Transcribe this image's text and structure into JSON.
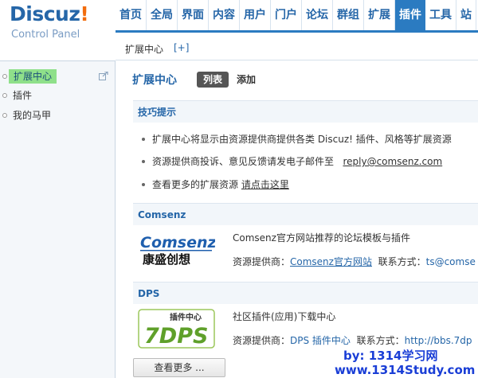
{
  "logo": {
    "brand": "Discuz",
    "brand_exclaim": "!",
    "subtitle": "Control Panel"
  },
  "nav": [
    "首页",
    "全局",
    "界面",
    "内容",
    "用户",
    "门户",
    "论坛",
    "群组",
    "扩展",
    "插件",
    "工具",
    "站"
  ],
  "nav_active_index": 9,
  "subbar": {
    "crumb": "扩展中心",
    "plus": "[+]"
  },
  "sidebar": {
    "items": [
      "扩展中心",
      "插件",
      "我的马甲"
    ],
    "active_index": 0
  },
  "content": {
    "title": "扩展中心",
    "tab_list": "列表",
    "tab_add": "添加",
    "tips": {
      "head": "技巧提示",
      "line1": "扩展中心将显示由资源提供商提供各类 Discuz! 插件、风格等扩展资源",
      "line2_text": "资源提供商投诉、意见反馈请发电子邮件至",
      "line2_email": "reply@comsenz.com",
      "line3_text": "查看更多的扩展资源",
      "line3_link": "请点击这里"
    },
    "comsenz": {
      "head": "Comsenz",
      "logo_top": "Comsenz",
      "logo_bottom": "康盛创想",
      "desc": "Comsenz官方网站推荐的论坛模板与插件",
      "meta_label": "资源提供商：",
      "meta_link": "Comsenz官方网站",
      "contact_label": "联系方式：",
      "contact_value": "ts@comse"
    },
    "dps": {
      "head": "DPS",
      "logo_top": "插件中心",
      "logo_bottom": "7DPS",
      "desc": "社区插件(应用)下载中心",
      "meta_label": "资源提供商：",
      "meta_link": "DPS 插件中心",
      "contact_label": "联系方式：",
      "contact_value": "http://bbs.7dp"
    },
    "more_button": "查看更多 ..."
  },
  "watermark": {
    "line1": "by: 1314学习网",
    "line2": "www.1314Study.com"
  },
  "colors": {
    "accent": "#2b7bc1",
    "link": "#2566a8",
    "sidebar_active": "#8fe08a",
    "watermark": "#1a3ed6"
  }
}
